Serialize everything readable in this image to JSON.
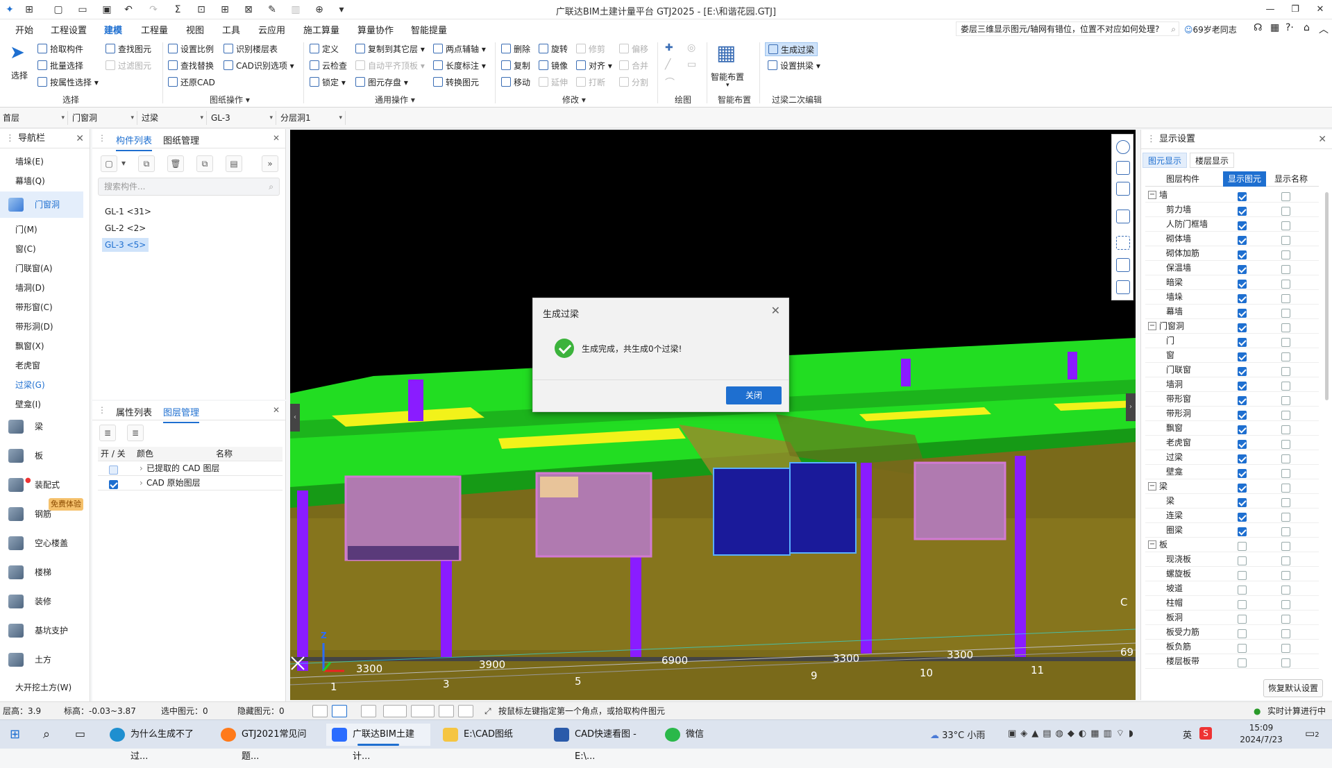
{
  "titlebar": {
    "title": "广联达BIM土建计量平台 GTJ2025 - [E:\\和谐花园.GTJ]",
    "qa_icons": [
      "app-logo-icon",
      "new-icon",
      "new-file-icon",
      "open-icon",
      "save-icon",
      "undo-icon",
      "redo-icon",
      "sum-icon",
      "tool1-icon",
      "tool2-icon",
      "tool3-icon",
      "tool4-icon",
      "tool5-icon",
      "tool6-icon",
      "more-icon"
    ]
  },
  "menu": [
    "开始",
    "工程设置",
    "建模",
    "工程量",
    "视图",
    "工具",
    "云应用",
    "施工算量",
    "算量协作",
    "智能提量"
  ],
  "menu_active": "建模",
  "help": {
    "search": "娄层三维显示图元/轴网有错位，位置不对应如何处理?",
    "user": "69岁老同志"
  },
  "ribbon": {
    "select": "选择",
    "pick": "拾取构件",
    "batch": "批量选择",
    "by_attr": "按属性选择",
    "find": "查找图元",
    "filter": "过滤图元",
    "set_scale": "设置比例",
    "find_replace": "查找替换",
    "restore_cad": "还原CAD",
    "recognize_layer": "识别楼层表",
    "cad_options": "CAD识别选项",
    "define": "定义",
    "cloud_check": "云检查",
    "lock": "锁定",
    "copy_to": "复制到其它层",
    "auto_align": "自动平齐顶板",
    "save_elem": "图元存盘",
    "two_point": "两点辅轴",
    "length_dim": "长度标注",
    "convert": "转换图元",
    "delete": "删除",
    "copy": "复制",
    "move": "移动",
    "rotate": "旋转",
    "mirror": "镜像",
    "extend": "延伸",
    "trim": "修剪",
    "align": "对齐",
    "break": "打断",
    "offset": "偏移",
    "merge": "合并",
    "split": "分割",
    "smart_layout": "智能布置",
    "gen_lintel": "生成过梁",
    "set_arch": "设置拱梁",
    "groups": [
      "选择",
      "图纸操作",
      "通用操作",
      "修改",
      "绘图",
      "智能布置",
      "过梁二次编辑"
    ]
  },
  "selectors": {
    "floor": "首层",
    "category": "门窗洞",
    "type": "过梁",
    "name": "GL-3",
    "sublayer": "分层洞1"
  },
  "nav": {
    "title": "导航栏",
    "items": [
      "墙垛(E)",
      "幕墙(Q)"
    ],
    "active_group": "门窗洞",
    "sub_items": [
      "门(M)",
      "窗(C)",
      "门联窗(A)",
      "墙洞(D)",
      "带形窗(C)",
      "带形洞(D)",
      "飘窗(X)",
      "老虎窗",
      "过梁(G)",
      "壁龛(I)"
    ],
    "active_item": "过梁(G)",
    "groups": [
      "梁",
      "板",
      "装配式",
      "钢筋",
      "空心楼盖",
      "楼梯",
      "装修",
      "基坑支护",
      "土方"
    ],
    "badge": "免费体验",
    "bottom": "大开挖土方(W)"
  },
  "components": {
    "tabs": [
      "构件列表",
      "图纸管理"
    ],
    "search_placeholder": "搜索构件...",
    "items": [
      "GL-1 <31>",
      "GL-2 <2>",
      "GL-3 <5>"
    ],
    "selected": "GL-3 <5>"
  },
  "layers": {
    "tabs": [
      "属性列表",
      "图层管理"
    ],
    "cols": [
      "开 / 关",
      "颜色",
      "名称"
    ],
    "rows": [
      "已提取的 CAD 图层",
      "CAD 原始图层"
    ]
  },
  "dialog": {
    "title": "生成过梁",
    "message": "生成完成，共生成0个过梁!",
    "close": "关闭"
  },
  "viewport": {
    "dims": [
      "3300",
      "3900",
      "6900",
      "3300",
      "3300",
      "69"
    ],
    "axes": [
      "1",
      "3",
      "5",
      "9",
      "10",
      "11"
    ],
    "corner": "C",
    "axis_z": "Z"
  },
  "display": {
    "title": "显示设置",
    "tabs": [
      "图元显示",
      "楼层显示"
    ],
    "cols": [
      "图层构件",
      "显示图元",
      "显示名称"
    ],
    "rows": [
      {
        "name": "墙",
        "group": true,
        "show": true
      },
      {
        "name": "剪力墙",
        "show": true
      },
      {
        "name": "人防门框墙",
        "show": true
      },
      {
        "name": "砌体墙",
        "show": true
      },
      {
        "name": "砌体加筋",
        "show": true
      },
      {
        "name": "保温墙",
        "show": true
      },
      {
        "name": "暗梁",
        "show": true
      },
      {
        "name": "墙垛",
        "show": true
      },
      {
        "name": "幕墙",
        "show": true
      },
      {
        "name": "门窗洞",
        "group": true,
        "show": true
      },
      {
        "name": "门",
        "show": true
      },
      {
        "name": "窗",
        "show": true
      },
      {
        "name": "门联窗",
        "show": true
      },
      {
        "name": "墙洞",
        "show": true
      },
      {
        "name": "带形窗",
        "show": true
      },
      {
        "name": "带形洞",
        "show": true
      },
      {
        "name": "飘窗",
        "show": true
      },
      {
        "name": "老虎窗",
        "show": true
      },
      {
        "name": "过梁",
        "show": true
      },
      {
        "name": "壁龛",
        "show": true
      },
      {
        "name": "梁",
        "group": true,
        "show": true
      },
      {
        "name": "梁",
        "show": true
      },
      {
        "name": "连梁",
        "show": true
      },
      {
        "name": "圈梁",
        "show": true
      },
      {
        "name": "板",
        "group": true,
        "show": false
      },
      {
        "name": "现浇板",
        "show": false
      },
      {
        "name": "螺旋板",
        "show": false
      },
      {
        "name": "坡道",
        "show": false
      },
      {
        "name": "柱帽",
        "show": false
      },
      {
        "name": "板洞",
        "show": false
      },
      {
        "name": "板受力筋",
        "show": false
      },
      {
        "name": "板负筋",
        "show": false
      },
      {
        "name": "楼层板带",
        "show": false
      }
    ],
    "restore": "恢复默认设置"
  },
  "status": {
    "height": "层高：3.9",
    "elev": "标高：-0.03~3.87",
    "selected": "选中图元：0",
    "hidden": "隐藏图元：0",
    "hint": "按鼠标左键指定第一个角点，或拾取构件图元",
    "realtime": "实时计算进行中"
  },
  "taskbar": {
    "items": [
      "为什么生成不了过...",
      "GTJ2021常见问题...",
      "广联达BIM土建计...",
      "E:\\CAD图纸",
      "CAD快速看图 - E:\\...",
      "微信"
    ],
    "weather": "33°C 小雨",
    "ime": "英",
    "time": "15:09",
    "date": "2024/7/23",
    "notif": "2"
  }
}
